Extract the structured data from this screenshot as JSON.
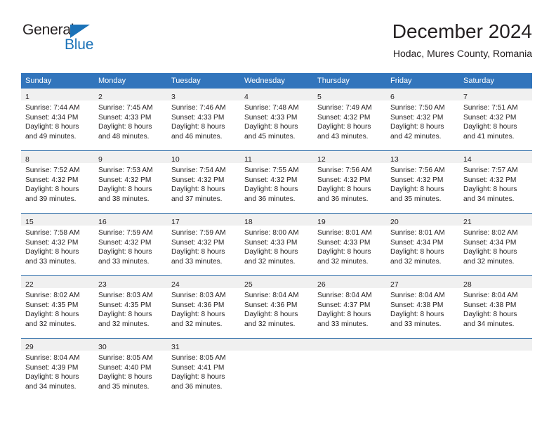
{
  "logo": {
    "word_top": "General",
    "word_bottom": "Blue",
    "triangle_icon": "blue-triangle-icon",
    "brand_color": "#1b72b8"
  },
  "header": {
    "title": "December 2024",
    "subtitle": "Hodac, Mures County, Romania"
  },
  "theme": {
    "header_blue": "#3275bc",
    "row_divider": "#2e6da8",
    "daynum_band": "#f0f0f0",
    "text": "#231f20"
  },
  "weekdays": [
    "Sunday",
    "Monday",
    "Tuesday",
    "Wednesday",
    "Thursday",
    "Friday",
    "Saturday"
  ],
  "weeks": [
    [
      {
        "day": "1",
        "sunrise": "Sunrise: 7:44 AM",
        "sunset": "Sunset: 4:34 PM",
        "daylight_line1": "Daylight: 8 hours",
        "daylight_line2": "and 49 minutes."
      },
      {
        "day": "2",
        "sunrise": "Sunrise: 7:45 AM",
        "sunset": "Sunset: 4:33 PM",
        "daylight_line1": "Daylight: 8 hours",
        "daylight_line2": "and 48 minutes."
      },
      {
        "day": "3",
        "sunrise": "Sunrise: 7:46 AM",
        "sunset": "Sunset: 4:33 PM",
        "daylight_line1": "Daylight: 8 hours",
        "daylight_line2": "and 46 minutes."
      },
      {
        "day": "4",
        "sunrise": "Sunrise: 7:48 AM",
        "sunset": "Sunset: 4:33 PM",
        "daylight_line1": "Daylight: 8 hours",
        "daylight_line2": "and 45 minutes."
      },
      {
        "day": "5",
        "sunrise": "Sunrise: 7:49 AM",
        "sunset": "Sunset: 4:32 PM",
        "daylight_line1": "Daylight: 8 hours",
        "daylight_line2": "and 43 minutes."
      },
      {
        "day": "6",
        "sunrise": "Sunrise: 7:50 AM",
        "sunset": "Sunset: 4:32 PM",
        "daylight_line1": "Daylight: 8 hours",
        "daylight_line2": "and 42 minutes."
      },
      {
        "day": "7",
        "sunrise": "Sunrise: 7:51 AM",
        "sunset": "Sunset: 4:32 PM",
        "daylight_line1": "Daylight: 8 hours",
        "daylight_line2": "and 41 minutes."
      }
    ],
    [
      {
        "day": "8",
        "sunrise": "Sunrise: 7:52 AM",
        "sunset": "Sunset: 4:32 PM",
        "daylight_line1": "Daylight: 8 hours",
        "daylight_line2": "and 39 minutes."
      },
      {
        "day": "9",
        "sunrise": "Sunrise: 7:53 AM",
        "sunset": "Sunset: 4:32 PM",
        "daylight_line1": "Daylight: 8 hours",
        "daylight_line2": "and 38 minutes."
      },
      {
        "day": "10",
        "sunrise": "Sunrise: 7:54 AM",
        "sunset": "Sunset: 4:32 PM",
        "daylight_line1": "Daylight: 8 hours",
        "daylight_line2": "and 37 minutes."
      },
      {
        "day": "11",
        "sunrise": "Sunrise: 7:55 AM",
        "sunset": "Sunset: 4:32 PM",
        "daylight_line1": "Daylight: 8 hours",
        "daylight_line2": "and 36 minutes."
      },
      {
        "day": "12",
        "sunrise": "Sunrise: 7:56 AM",
        "sunset": "Sunset: 4:32 PM",
        "daylight_line1": "Daylight: 8 hours",
        "daylight_line2": "and 36 minutes."
      },
      {
        "day": "13",
        "sunrise": "Sunrise: 7:56 AM",
        "sunset": "Sunset: 4:32 PM",
        "daylight_line1": "Daylight: 8 hours",
        "daylight_line2": "and 35 minutes."
      },
      {
        "day": "14",
        "sunrise": "Sunrise: 7:57 AM",
        "sunset": "Sunset: 4:32 PM",
        "daylight_line1": "Daylight: 8 hours",
        "daylight_line2": "and 34 minutes."
      }
    ],
    [
      {
        "day": "15",
        "sunrise": "Sunrise: 7:58 AM",
        "sunset": "Sunset: 4:32 PM",
        "daylight_line1": "Daylight: 8 hours",
        "daylight_line2": "and 33 minutes."
      },
      {
        "day": "16",
        "sunrise": "Sunrise: 7:59 AM",
        "sunset": "Sunset: 4:32 PM",
        "daylight_line1": "Daylight: 8 hours",
        "daylight_line2": "and 33 minutes."
      },
      {
        "day": "17",
        "sunrise": "Sunrise: 7:59 AM",
        "sunset": "Sunset: 4:32 PM",
        "daylight_line1": "Daylight: 8 hours",
        "daylight_line2": "and 33 minutes."
      },
      {
        "day": "18",
        "sunrise": "Sunrise: 8:00 AM",
        "sunset": "Sunset: 4:33 PM",
        "daylight_line1": "Daylight: 8 hours",
        "daylight_line2": "and 32 minutes."
      },
      {
        "day": "19",
        "sunrise": "Sunrise: 8:01 AM",
        "sunset": "Sunset: 4:33 PM",
        "daylight_line1": "Daylight: 8 hours",
        "daylight_line2": "and 32 minutes."
      },
      {
        "day": "20",
        "sunrise": "Sunrise: 8:01 AM",
        "sunset": "Sunset: 4:34 PM",
        "daylight_line1": "Daylight: 8 hours",
        "daylight_line2": "and 32 minutes."
      },
      {
        "day": "21",
        "sunrise": "Sunrise: 8:02 AM",
        "sunset": "Sunset: 4:34 PM",
        "daylight_line1": "Daylight: 8 hours",
        "daylight_line2": "and 32 minutes."
      }
    ],
    [
      {
        "day": "22",
        "sunrise": "Sunrise: 8:02 AM",
        "sunset": "Sunset: 4:35 PM",
        "daylight_line1": "Daylight: 8 hours",
        "daylight_line2": "and 32 minutes."
      },
      {
        "day": "23",
        "sunrise": "Sunrise: 8:03 AM",
        "sunset": "Sunset: 4:35 PM",
        "daylight_line1": "Daylight: 8 hours",
        "daylight_line2": "and 32 minutes."
      },
      {
        "day": "24",
        "sunrise": "Sunrise: 8:03 AM",
        "sunset": "Sunset: 4:36 PM",
        "daylight_line1": "Daylight: 8 hours",
        "daylight_line2": "and 32 minutes."
      },
      {
        "day": "25",
        "sunrise": "Sunrise: 8:04 AM",
        "sunset": "Sunset: 4:36 PM",
        "daylight_line1": "Daylight: 8 hours",
        "daylight_line2": "and 32 minutes."
      },
      {
        "day": "26",
        "sunrise": "Sunrise: 8:04 AM",
        "sunset": "Sunset: 4:37 PM",
        "daylight_line1": "Daylight: 8 hours",
        "daylight_line2": "and 33 minutes."
      },
      {
        "day": "27",
        "sunrise": "Sunrise: 8:04 AM",
        "sunset": "Sunset: 4:38 PM",
        "daylight_line1": "Daylight: 8 hours",
        "daylight_line2": "and 33 minutes."
      },
      {
        "day": "28",
        "sunrise": "Sunrise: 8:04 AM",
        "sunset": "Sunset: 4:38 PM",
        "daylight_line1": "Daylight: 8 hours",
        "daylight_line2": "and 34 minutes."
      }
    ],
    [
      {
        "day": "29",
        "sunrise": "Sunrise: 8:04 AM",
        "sunset": "Sunset: 4:39 PM",
        "daylight_line1": "Daylight: 8 hours",
        "daylight_line2": "and 34 minutes."
      },
      {
        "day": "30",
        "sunrise": "Sunrise: 8:05 AM",
        "sunset": "Sunset: 4:40 PM",
        "daylight_line1": "Daylight: 8 hours",
        "daylight_line2": "and 35 minutes."
      },
      {
        "day": "31",
        "sunrise": "Sunrise: 8:05 AM",
        "sunset": "Sunset: 4:41 PM",
        "daylight_line1": "Daylight: 8 hours",
        "daylight_line2": "and 36 minutes."
      },
      {
        "day": "",
        "sunrise": "",
        "sunset": "",
        "daylight_line1": "",
        "daylight_line2": ""
      },
      {
        "day": "",
        "sunrise": "",
        "sunset": "",
        "daylight_line1": "",
        "daylight_line2": ""
      },
      {
        "day": "",
        "sunrise": "",
        "sunset": "",
        "daylight_line1": "",
        "daylight_line2": ""
      },
      {
        "day": "",
        "sunrise": "",
        "sunset": "",
        "daylight_line1": "",
        "daylight_line2": ""
      }
    ]
  ]
}
